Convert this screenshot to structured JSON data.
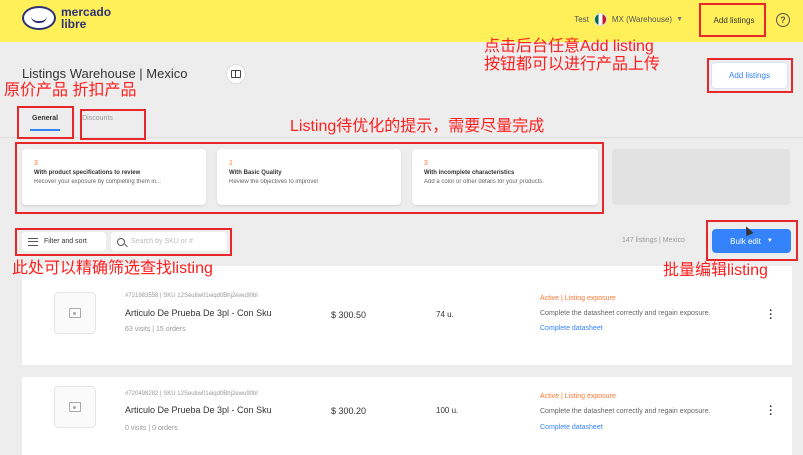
{
  "header": {
    "logo_text": "mercado libre",
    "user": "Test",
    "warehouse": "MX (Warehouse)",
    "add_listings": "Add listings",
    "help_icon": "?"
  },
  "page": {
    "title": "Listings Warehouse | Mexico",
    "add_listings_button": "Add listings",
    "tabs": [
      "General",
      "Discounts"
    ]
  },
  "cards": [
    {
      "number": "3",
      "title": "With product specifications to review",
      "desc": "Recover your exposure by completing them in..."
    },
    {
      "number": "1",
      "title": "With Basic Quality",
      "desc": "Review the objectives to improve!"
    },
    {
      "number": "3",
      "title": "With incomplete characteristics",
      "desc": "Add a color or other details for your products."
    }
  ],
  "filters": {
    "filter_sort_label": "Filter and sort",
    "search_placeholder": "Search by SKU or #",
    "count": "147 listings | Mexico",
    "bulk_edit": "Bulk edit"
  },
  "listings": [
    {
      "sku": "#721983558 | SKU 12Seutiw01eiqd0Bhj2ewu90bl",
      "title": "Articulo De Prueba De 3pl - Con Sku",
      "visits": "63 visits | 15 orders",
      "price": "$ 300.50",
      "units": "74 u.",
      "status": "Active | Listing exposure",
      "status_desc": "Complete the datasheet correctly and regain exposure.",
      "datasheet": "Complete datasheet"
    },
    {
      "sku": "#720498282 | SKU 12Seutiw01eiqd0Bhj2ewu90bl",
      "title": "Articulo De Prueba De 3pl - Con Sku",
      "visits": "0 visits | 0 orders",
      "price": "$ 300.20",
      "units": "100 u.",
      "status": "Active | Listing exposure",
      "status_desc": "Complete the datasheet correctly and regain exposure.",
      "datasheet": "Complete datasheet"
    }
  ],
  "annotations": {
    "add_listing": "点击后台任意Add listing\n按钮都可以进行产品上传",
    "price_tabs": "原价产品 折扣产品",
    "listing_hint": "Listing待优化的提示，需要尽量完成",
    "filter": "此处可以精确筛选查找listing",
    "bulk": "批量编辑listing"
  },
  "colors": {
    "brand_yellow": "#fff059",
    "brand_blue": "#3483fa",
    "annotation_red": "#e8272a",
    "status_orange": "#ff7733"
  }
}
